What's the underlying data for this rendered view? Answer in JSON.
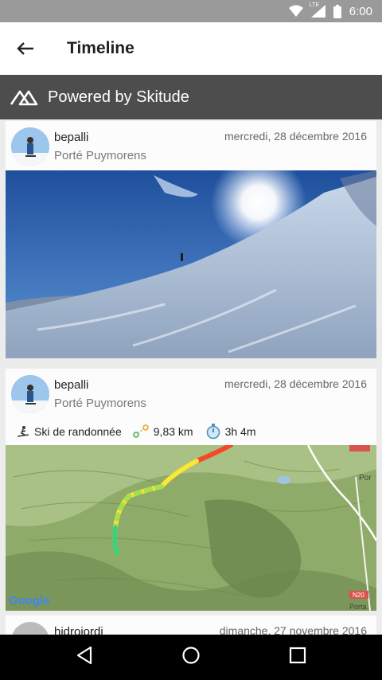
{
  "status": {
    "time": "6:00",
    "network": "LTE"
  },
  "header": {
    "title": "Timeline"
  },
  "banner": {
    "text": "Powered by Skitude"
  },
  "feed": [
    {
      "user": "bepalli",
      "place": "Porté Puymorens",
      "date": "mercredi, 28 décembre 2016"
    },
    {
      "user": "bepalli",
      "place": "Porté Puymorens",
      "date": "mercredi, 28 décembre 2016",
      "activity": "Ski de randonnée",
      "distance": "9,83 km",
      "duration": "3h 4m",
      "map": {
        "attribution": "Google",
        "road_label": "N20",
        "town_label": "Porta",
        "side_label": "Por"
      }
    },
    {
      "user": "hidroiordi",
      "date": "dimanche, 27 novembre 2016"
    }
  ],
  "colors": {
    "statusbar": "#9a9a9a",
    "banner": "#4d4d4d",
    "navbar": "#000000"
  }
}
